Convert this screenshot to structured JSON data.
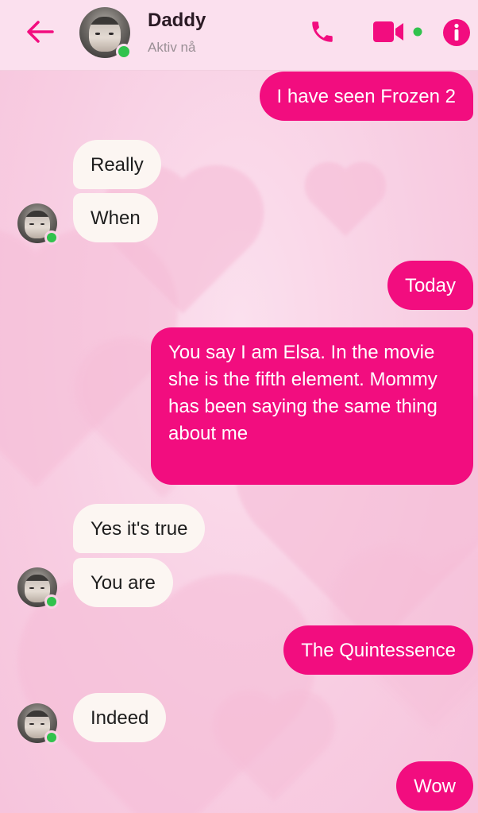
{
  "header": {
    "contact_name": "Daddy",
    "status": "Aktiv nå",
    "icons": {
      "back": "arrow-left-icon",
      "call": "phone-icon",
      "video": "video-camera-icon",
      "info": "info-icon"
    },
    "accent_color": "#f20d7f",
    "online_color": "#31c24d"
  },
  "messages": [
    {
      "direction": "outgoing",
      "text": "I have seen Frozen 2"
    },
    {
      "direction": "incoming",
      "text": "Really"
    },
    {
      "direction": "incoming",
      "text": "When"
    },
    {
      "direction": "outgoing",
      "text": "Today"
    },
    {
      "direction": "outgoing",
      "text": "You say I am Elsa. In the movie she is the fifth element. Mommy has been saying the same thing about me"
    },
    {
      "direction": "incoming",
      "text": "Yes it's true"
    },
    {
      "direction": "incoming",
      "text": "You are"
    },
    {
      "direction": "outgoing",
      "text": "The Quintessence"
    },
    {
      "direction": "incoming",
      "text": "Indeed"
    },
    {
      "direction": "outgoing",
      "text": "Wow"
    }
  ]
}
